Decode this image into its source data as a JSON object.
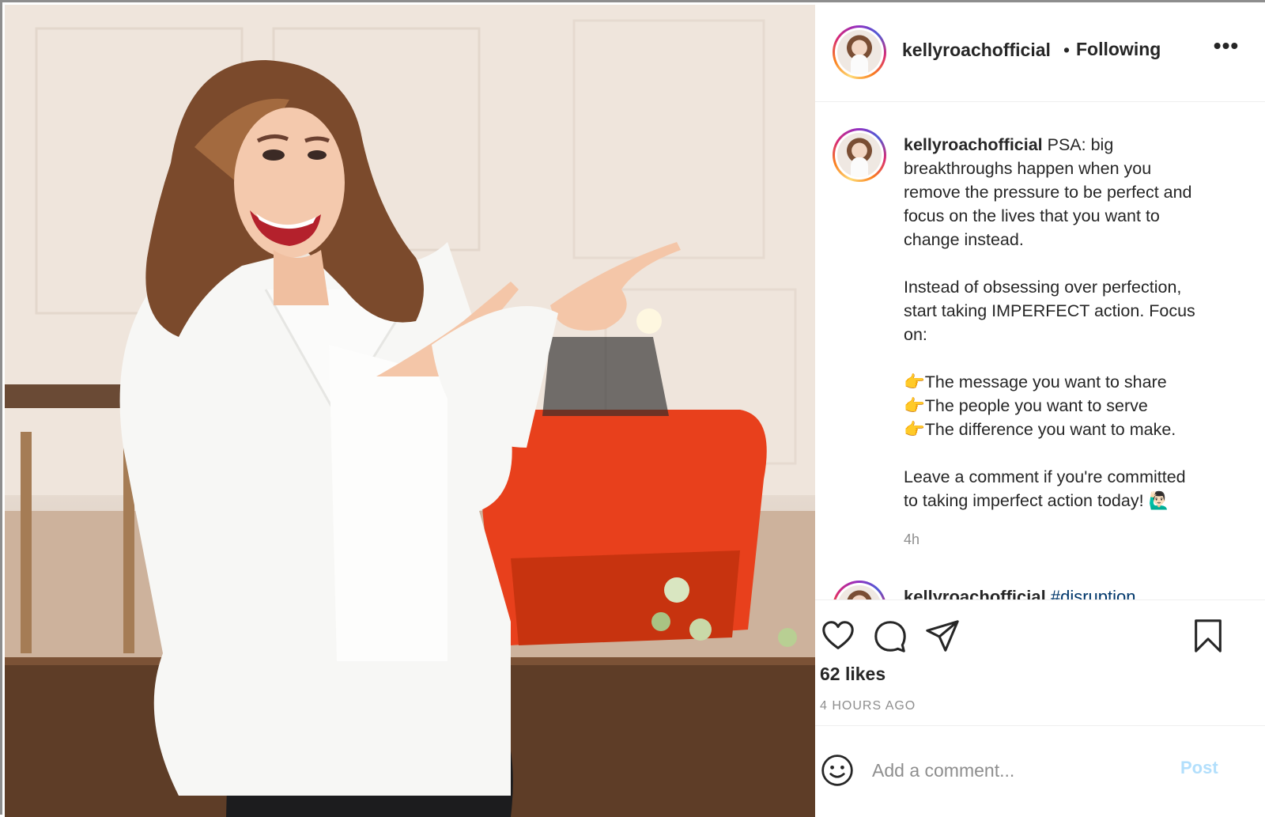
{
  "post": {
    "photo_description_icon": "post-photo",
    "username": "kellyroachofficial",
    "dot": "•",
    "follow_status": "Following",
    "more_label": "•••"
  },
  "caption": {
    "username": "kellyroachofficial",
    "text": " PSA: big\nbreakthroughs happen when you\nremove the pressure to be perfect and\nfocus on the lives that you want to\nchange instead.\n\nInstead of obsessing over perfection,\nstart taking IMPERFECT action. Focus\non:\n\n👉The message you want to share\n👉The people you want to serve\n👉The difference you want to make.\n\nLeave a comment if you're committed\nto taking imperfect action today! 🙋🏻‍♂️",
    "time": "4h"
  },
  "next_comment": {
    "username": "kellyroachofficial",
    "hashtag": "#disruption"
  },
  "actions": {
    "like_icon": "heart-icon",
    "comment_icon": "comment-icon",
    "share_icon": "paper-plane-icon",
    "save_icon": "bookmark-icon",
    "likes": "62 likes",
    "posted_ago": "4 HOURS AGO"
  },
  "add_comment": {
    "placeholder": "Add a comment...",
    "post_label": "Post",
    "emoji_icon": "smiley-icon"
  },
  "colors": {
    "accent_link": "#00376b",
    "post_disabled": "#b2dffc",
    "secondary_text": "#8e8e8e"
  }
}
